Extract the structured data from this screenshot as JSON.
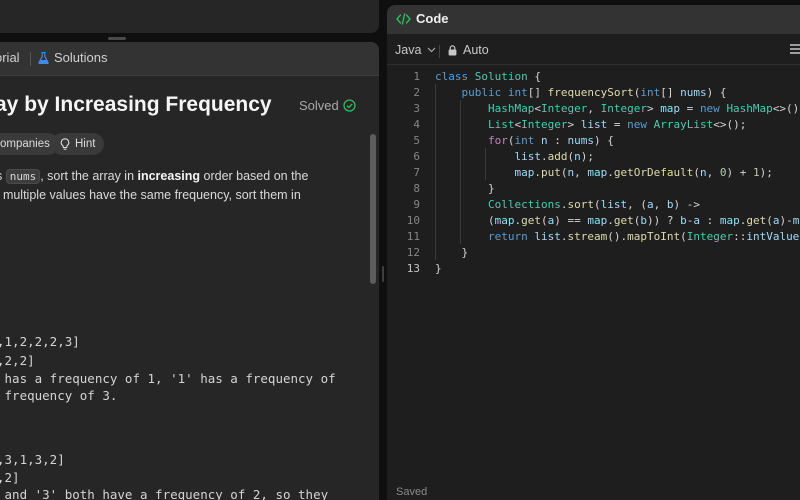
{
  "problem": {
    "tabs": {
      "editorial": "orial",
      "solutions": "Solutions"
    },
    "title": "ay by Increasing Frequency",
    "status": "Solved",
    "chips": {
      "companies": "ompanies",
      "hint": "Hint"
    },
    "description": {
      "l1_pre": "s ",
      "l1_code": "nums",
      "l1_mid": ", sort the array in ",
      "l1_bold": "increasing",
      "l1_post": " order based on the",
      "l2": "f multiple values have the same frequency, sort them in"
    },
    "examples": [
      ",1,2,2,2,3]",
      ",2,2]",
      " has a frequency of 1, '1' has a frequency of",
      " frequency of 3.",
      ",3,1,3,2]",
      ",2]",
      " and '3' both have a frequency of 2, so they"
    ]
  },
  "editor": {
    "header_title": "Code",
    "language": "Java",
    "format_mode": "Auto",
    "save_status": "Saved",
    "line_numbers": [
      "1",
      "2",
      "3",
      "4",
      "5",
      "6",
      "7",
      "8",
      "9",
      "10",
      "11",
      "12",
      "13"
    ],
    "code_lines": [
      "class Solution {",
      "    public int[] frequencySort(int[] nums) {",
      "        HashMap<Integer, Integer> map = new HashMap<>();",
      "        List<Integer> list = new ArrayList<>();",
      "        for(int n : nums) {",
      "            list.add(n);",
      "            map.put(n, map.getOrDefault(n, 0) + 1);",
      "        }",
      "        Collections.sort(list, (a, b) ->",
      "        (map.get(a) == map.get(b)) ? b-a : map.get(a)-map.g",
      "        return list.stream().mapToInt(Integer::intValue).to",
      "    }",
      "}"
    ]
  },
  "colors": {
    "accent_green": "#2cbb5d",
    "solutions_icon": "#3b8fe0",
    "keyword": "#569cd6",
    "type": "#4ec9b0"
  },
  "icons": [
    "flask-icon",
    "check-circle-icon",
    "bulb-icon",
    "code-brackets-icon",
    "chevron-down-icon",
    "lock-icon",
    "menu-icon"
  ]
}
